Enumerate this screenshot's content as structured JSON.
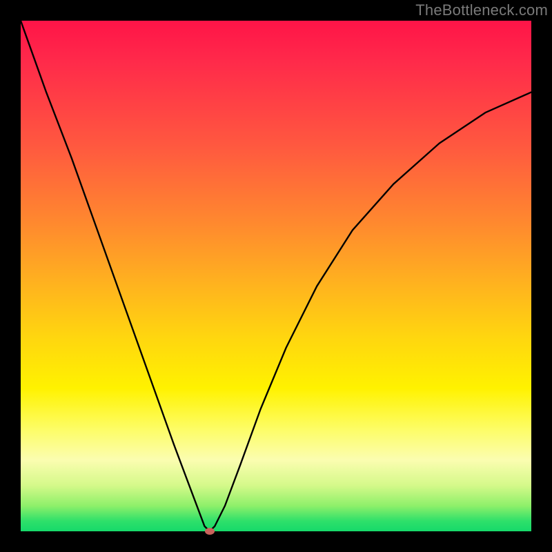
{
  "watermark": "TheBottleneck.com",
  "chart_data": {
    "type": "line",
    "title": "",
    "xlabel": "",
    "ylabel": "",
    "xlim": [
      0,
      100
    ],
    "ylim": [
      0,
      100
    ],
    "background_gradient": {
      "direction": "vertical",
      "stops": [
        {
          "pos": 0,
          "color": "#ff1448"
        },
        {
          "pos": 25,
          "color": "#ff5a3f"
        },
        {
          "pos": 50,
          "color": "#ffb41e"
        },
        {
          "pos": 72,
          "color": "#fff200"
        },
        {
          "pos": 90,
          "color": "#d5f98a"
        },
        {
          "pos": 100,
          "color": "#16d96a"
        }
      ]
    },
    "series": [
      {
        "name": "bottleneck-curve",
        "x": [
          0,
          5,
          10,
          15,
          20,
          25,
          30,
          33,
          36,
          37,
          38,
          40,
          43,
          47,
          52,
          58,
          65,
          73,
          82,
          91,
          100
        ],
        "y": [
          100,
          86,
          73,
          59,
          45,
          31,
          17,
          9,
          1,
          0,
          1,
          5,
          13,
          24,
          36,
          48,
          59,
          68,
          76,
          82,
          86
        ]
      }
    ],
    "marker": {
      "name": "optimal-point",
      "x": 37,
      "y": 0,
      "color": "#c9635c"
    },
    "grid": false,
    "legend": false
  }
}
